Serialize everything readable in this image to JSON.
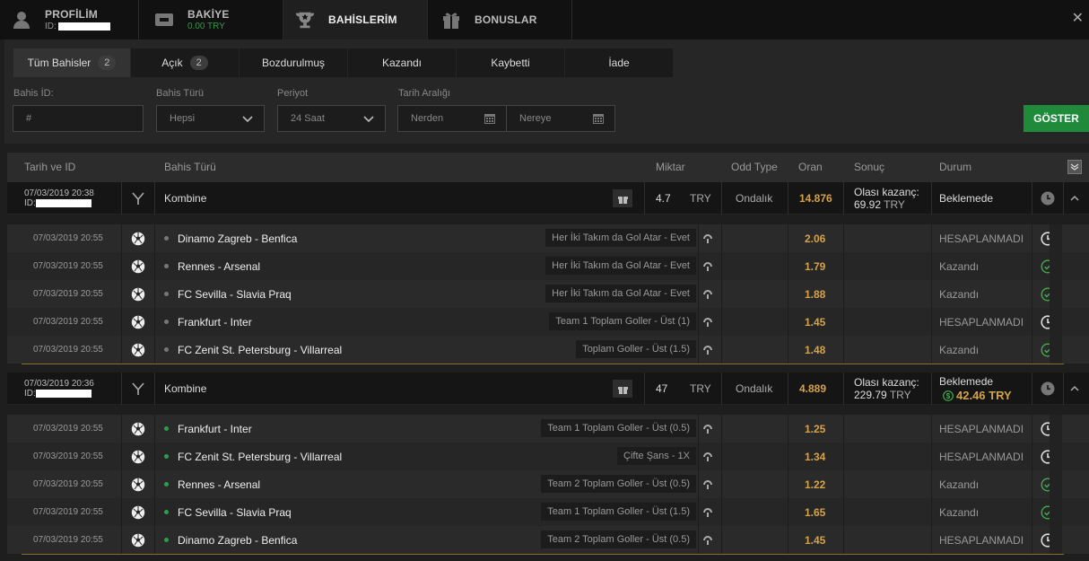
{
  "topnav": {
    "profile": {
      "title": "PROFİLİM",
      "sub": "ID:"
    },
    "balance": {
      "title": "BAKİYE",
      "sub": "0.00 TRY"
    },
    "bets": {
      "title": "BAHİSLERİM"
    },
    "bonus": {
      "title": "BONUSLAR"
    }
  },
  "tabs": [
    {
      "label": "Tüm Bahisler",
      "count": "2"
    },
    {
      "label": "Açık",
      "count": "2"
    },
    {
      "label": "Bozdurulmuş"
    },
    {
      "label": "Kazandı"
    },
    {
      "label": "Kaybetti"
    },
    {
      "label": "İade"
    }
  ],
  "filters": {
    "bet_id_label": "Bahis İD:",
    "bet_id_placeholder": "#",
    "bet_type_label": "Bahis Türü",
    "bet_type_value": "Hepsi",
    "period_label": "Periyot",
    "period_value": "24 Saat",
    "date_label": "Tarih Aralığı",
    "date_from": "Nerden",
    "date_to": "Nereye",
    "show_button": "GÖSTER"
  },
  "columns": {
    "date": "Tarih ve ID",
    "type": "Bahis Türü",
    "amount": "Miktar",
    "oddtype": "Odd Type",
    "odds": "Oran",
    "result": "Sonuç",
    "status": "Durum"
  },
  "bets": [
    {
      "date": "07/03/2019 20:38",
      "id_label": "ID:",
      "type": "Kombine",
      "amount": "4.7",
      "currency": "TRY",
      "oddtype": "Ondalık",
      "odds": "14.876",
      "win_label": "Olası kazanç:",
      "win_value": "69.92",
      "win_currency": "TRY",
      "status": "Beklemede",
      "cashout": "",
      "selections": [
        {
          "date": "07/03/2019 20:55",
          "match": "Dinamo Zagreb - Benfica",
          "market": "Her İki Takım da Gol Atar - Evet",
          "odds": "2.06",
          "status": "HESAPLANMADI",
          "state": "pending"
        },
        {
          "date": "07/03/2019 20:55",
          "match": "Rennes - Arsenal",
          "market": "Her İki Takım da Gol Atar - Evet",
          "odds": "1.79",
          "status": "Kazandı",
          "state": "won"
        },
        {
          "date": "07/03/2019 20:55",
          "match": "FC Sevilla - Slavia Praq",
          "market": "Her İki Takım da Gol Atar - Evet",
          "odds": "1.88",
          "status": "Kazandı",
          "state": "won"
        },
        {
          "date": "07/03/2019 20:55",
          "match": "Frankfurt - Inter",
          "market": "Team 1 Toplam Goller - Üst (1)",
          "odds": "1.45",
          "status": "HESAPLANMADI",
          "state": "pending"
        },
        {
          "date": "07/03/2019 20:55",
          "match": "FC Zenit St. Petersburg - Villarreal",
          "market": "Toplam Goller - Üst (1.5)",
          "odds": "1.48",
          "status": "Kazandı",
          "state": "won"
        }
      ]
    },
    {
      "date": "07/03/2019 20:36",
      "id_label": "ID:",
      "type": "Kombine",
      "amount": "47",
      "currency": "TRY",
      "oddtype": "Ondalık",
      "odds": "4.889",
      "win_label": "Olası kazanç:",
      "win_value": "229.79",
      "win_currency": "TRY",
      "status": "Beklemede",
      "cashout": "42.46 TRY",
      "selections": [
        {
          "date": "07/03/2019 20:55",
          "match": "Frankfurt - Inter",
          "market": "Team 1 Toplam Goller - Üst (0.5)",
          "odds": "1.25",
          "status": "HESAPLANMADI",
          "state": "pending"
        },
        {
          "date": "07/03/2019 20:55",
          "match": "FC Zenit St. Petersburg - Villarreal",
          "market": "Çifte Şans - 1X",
          "odds": "1.34",
          "status": "HESAPLANMADI",
          "state": "pending"
        },
        {
          "date": "07/03/2019 20:55",
          "match": "Rennes - Arsenal",
          "market": "Team 2 Toplam Goller - Üst (0.5)",
          "odds": "1.22",
          "status": "Kazandı",
          "state": "won"
        },
        {
          "date": "07/03/2019 20:55",
          "match": "FC Sevilla - Slavia Praq",
          "market": "Team 1 Toplam Goller - Üst (1.5)",
          "odds": "1.65",
          "status": "Kazandı",
          "state": "won"
        },
        {
          "date": "07/03/2019 20:55",
          "match": "Dinamo Zagreb - Benfica",
          "market": "Team 2 Toplam Goller - Üst (0.5)",
          "odds": "1.45",
          "status": "HESAPLANMADI",
          "state": "pending"
        }
      ]
    }
  ],
  "colors": {
    "accent_gold": "#d4a24a",
    "green": "#1f8a3a",
    "won": "#3fae49"
  },
  "icons": {
    "profile": "user-icon",
    "balance": "wallet-icon",
    "bets": "trophy-icon",
    "bonus": "gift-icon",
    "close": "close-icon"
  }
}
